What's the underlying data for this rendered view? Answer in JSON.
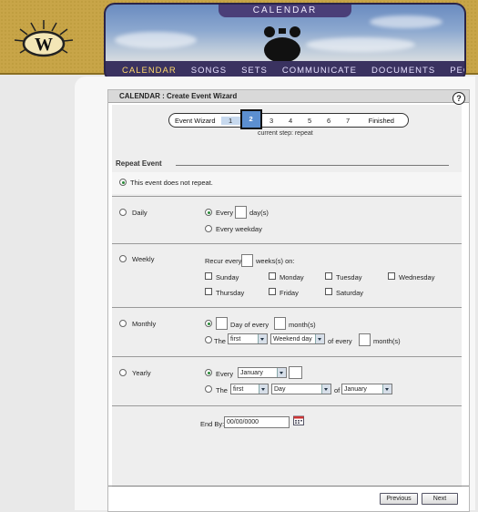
{
  "header": {
    "title": "CALENDAR",
    "nav": [
      "CALENDAR",
      "SONGS",
      "SETS",
      "COMMUNICATE",
      "DOCUMENTS",
      "PEOPLE"
    ]
  },
  "panel": {
    "title": "CALENDAR : Create Event Wizard",
    "help": "?"
  },
  "wizard": {
    "label": "Event Wizard",
    "steps": [
      "1",
      "2",
      "3",
      "4",
      "5",
      "6",
      "7"
    ],
    "finished": "Finished",
    "current_step": "current step: repeat"
  },
  "repeat": {
    "heading": "Repeat Event",
    "no_repeat": "This event does not repeat.",
    "daily": {
      "label": "Daily",
      "every": "Every",
      "days": "day(s)",
      "every_weekday": "Every weekday"
    },
    "weekly": {
      "label": "Weekly",
      "recur": "Recur every",
      "weeks_on": "weeks(s) on:",
      "days": [
        "Sunday",
        "Monday",
        "Tuesday",
        "Wednesday",
        "Thursday",
        "Friday",
        "Saturday"
      ]
    },
    "monthly": {
      "label": "Monthly",
      "day_of_every": "Day of every",
      "months": "month(s)",
      "the": "The",
      "ordinal": "first",
      "daytype": "Weekend day",
      "of_every": "of every",
      "months2": "month(s)"
    },
    "yearly": {
      "label": "Yearly",
      "every": "Every",
      "month": "January",
      "the": "The",
      "ordinal": "first",
      "daytype": "Day",
      "of": "of",
      "month2": "January"
    },
    "end_by": {
      "label": "End By:",
      "value": "00/00/0000"
    }
  },
  "buttons": {
    "previous": "Previous",
    "next": "Next"
  }
}
